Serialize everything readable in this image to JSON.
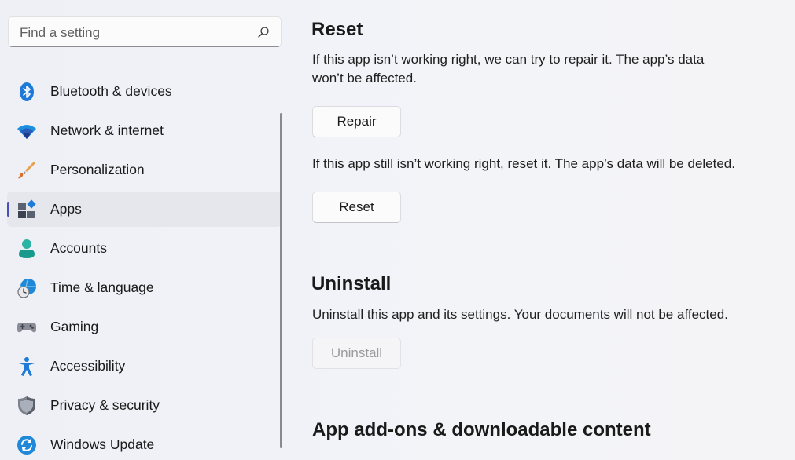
{
  "search": {
    "placeholder": "Find a setting",
    "icon": "search-icon"
  },
  "sidebar": {
    "items": [
      {
        "label": "Bluetooth & devices",
        "icon": "bluetooth-icon",
        "active": false
      },
      {
        "label": "Network & internet",
        "icon": "wifi-icon",
        "active": false
      },
      {
        "label": "Personalization",
        "icon": "paintbrush-icon",
        "active": false
      },
      {
        "label": "Apps",
        "icon": "apps-icon",
        "active": true
      },
      {
        "label": "Accounts",
        "icon": "person-icon",
        "active": false
      },
      {
        "label": "Time & language",
        "icon": "globe-clock-icon",
        "active": false
      },
      {
        "label": "Gaming",
        "icon": "gamepad-icon",
        "active": false
      },
      {
        "label": "Accessibility",
        "icon": "accessibility-icon",
        "active": false
      },
      {
        "label": "Privacy & security",
        "icon": "shield-icon",
        "active": false
      },
      {
        "label": "Windows Update",
        "icon": "update-icon",
        "active": false
      }
    ],
    "accent": "#4b4fb8"
  },
  "main": {
    "reset": {
      "title": "Reset",
      "repair_desc": "If this app isn’t working right, we can try to repair it. The app’s data won’t be affected.",
      "repair_label": "Repair",
      "reset_desc": "If this app still isn’t working right, reset it. The app’s data will be deleted.",
      "reset_label": "Reset"
    },
    "uninstall": {
      "title": "Uninstall",
      "desc": "Uninstall this app and its settings. Your documents will not be affected.",
      "button_label": "Uninstall",
      "button_disabled": true
    },
    "addons": {
      "title": "App add-ons & downloadable content"
    }
  }
}
